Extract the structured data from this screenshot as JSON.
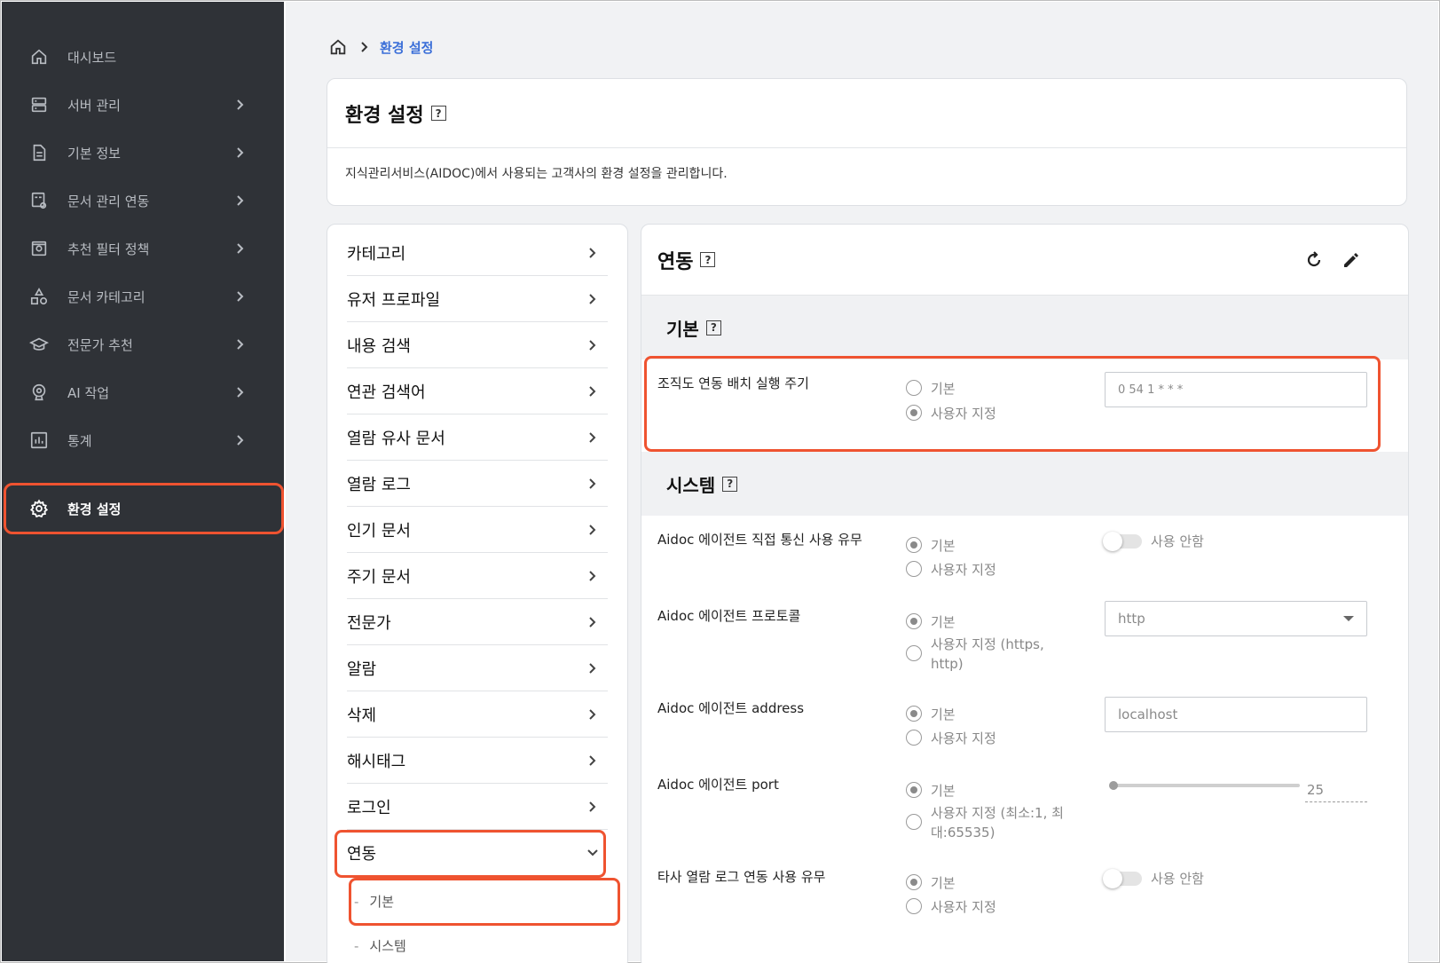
{
  "sidebar": {
    "items": [
      {
        "label": "대시보드",
        "icon": "home-icon"
      },
      {
        "label": "서버 관리",
        "icon": "server-icon"
      },
      {
        "label": "기본 정보",
        "icon": "document-icon"
      },
      {
        "label": "문서 관리 연동",
        "icon": "doc-link-icon"
      },
      {
        "label": "추천 필터 정책",
        "icon": "filter-icon"
      },
      {
        "label": "문서 카테고리",
        "icon": "shapes-icon"
      },
      {
        "label": "전문가 추천",
        "icon": "graduation-cap-icon"
      },
      {
        "label": "AI 작업",
        "icon": "ai-icon"
      },
      {
        "label": "통계",
        "icon": "chart-icon"
      },
      {
        "label": "환경 설정",
        "icon": "gear-icon"
      }
    ]
  },
  "breadcrumb": {
    "current": "환경 설정"
  },
  "page": {
    "title": "환경 설정",
    "help": "?",
    "description": "지식관리서비스(AIDOC)에서 사용되는 고객사의 환경 설정을 관리합니다."
  },
  "categories": {
    "items": [
      "카테고리",
      "유저 프로파일",
      "내용 검색",
      "연관 검색어",
      "열람 유사 문서",
      "열람 로그",
      "인기 문서",
      "주기 문서",
      "전문가",
      "알람",
      "삭제",
      "해시태그",
      "로그인",
      "연동"
    ],
    "subitems": [
      "기본",
      "시스템"
    ],
    "dash": "-"
  },
  "detail": {
    "title": "연동",
    "help": "?",
    "sections": {
      "basic": {
        "title": "기본",
        "help": "?"
      },
      "system": {
        "title": "시스템",
        "help": "?"
      }
    },
    "batch": {
      "label": "조직도 연동 배치 실행 주기",
      "opt_default": "기본",
      "opt_custom": "사용자 지정",
      "selected": "custom",
      "value": "0 54 1 * * *"
    },
    "direct": {
      "label": "Aidoc 에이전트 직접 통신 사용 유무",
      "opt_default": "기본",
      "opt_custom": "사용자 지정",
      "toggle_label": "사용 안함",
      "toggle_on": false
    },
    "protocol": {
      "label": "Aidoc 에이전트 프로토콜",
      "opt_default": "기본",
      "opt_custom_line1": "사용자 지정 (https,",
      "opt_custom_line2": "http)",
      "value": "http"
    },
    "address": {
      "label": "Aidoc 에이전트 address",
      "opt_default": "기본",
      "opt_custom": "사용자 지정",
      "value": "localhost"
    },
    "port": {
      "label": "Aidoc 에이전트 port",
      "opt_default": "기본",
      "opt_custom_line1": "사용자 지정 (최소:1, 최",
      "opt_custom_line2": "대:65535)",
      "value": "25"
    },
    "thirdparty": {
      "label": "타사 열람 로그 연동 사용 유무",
      "opt_default": "기본",
      "opt_custom": "사용자 지정",
      "toggle_label": "사용 안함",
      "toggle_on": false
    }
  },
  "colors": {
    "sidebar_bg": "#2f3237",
    "highlight": "#ef5330",
    "breadcrumb_active": "#3b6fd8"
  }
}
